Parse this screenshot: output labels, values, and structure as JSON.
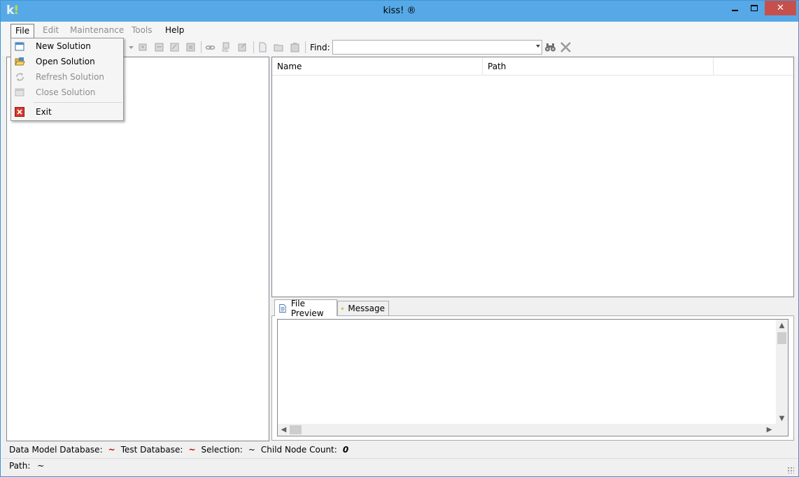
{
  "window": {
    "title": "kiss! ®",
    "logo_k": "k",
    "logo_bang": "!",
    "close_glyph": "✕"
  },
  "menubar": {
    "items": [
      {
        "label": "File",
        "state": "active"
      },
      {
        "label": "Edit",
        "state": "disabled"
      },
      {
        "label": "Maintenance",
        "state": "disabled"
      },
      {
        "label": "Tools",
        "state": "disabled"
      },
      {
        "label": "Help",
        "state": "enabled"
      }
    ]
  },
  "file_menu": {
    "items": [
      {
        "label": "New Solution",
        "icon": "new-solution-icon",
        "enabled": true
      },
      {
        "label": "Open Solution",
        "icon": "open-folder-icon",
        "enabled": true
      },
      {
        "label": "Refresh Solution",
        "icon": "refresh-icon",
        "enabled": false
      },
      {
        "label": "Close Solution",
        "icon": "close-solution-icon",
        "enabled": false
      },
      {
        "label": "Exit",
        "icon": "exit-icon",
        "enabled": true
      }
    ]
  },
  "toolbar": {
    "find_label": "Find:",
    "find_value": "",
    "icons": [
      "binoculars-icon",
      "clear-x-icon"
    ]
  },
  "list": {
    "columns": [
      "Name",
      "Path"
    ]
  },
  "tabs": [
    {
      "label": "File Preview",
      "selected": true,
      "icon": "document-icon"
    },
    {
      "label": "Message",
      "selected": false,
      "icon": "message-icon"
    }
  ],
  "status": {
    "data_model_label": "Data Model Database:",
    "data_model_value": "~",
    "test_db_label": "Test Database:",
    "test_db_value": "~",
    "selection_label": "Selection:",
    "selection_value": "~",
    "child_count_label": "Child Node Count:",
    "child_count_value": "0",
    "path_label": "Path:",
    "path_value": "~"
  },
  "colors": {
    "titlebar": "#57a8e6",
    "close_button": "#c7504c",
    "status_tilde": "#c00000"
  }
}
